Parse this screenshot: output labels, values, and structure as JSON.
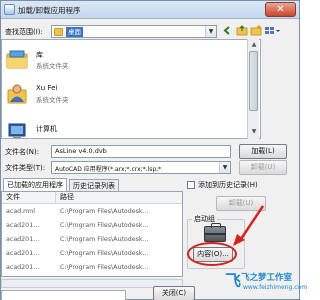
{
  "window": {
    "title": "加载/卸载应用程序",
    "close_label": "✕"
  },
  "look_in": {
    "label": "查找范围(I):",
    "value": "桌面"
  },
  "toolbar": {
    "icons": [
      "back-icon",
      "up-folder-icon",
      "new-folder-icon",
      "views-icon"
    ]
  },
  "files": [
    {
      "name": "库",
      "type": "系统文件夹",
      "icon": "library-icon"
    },
    {
      "name": "Xu Fei",
      "type": "系统文件夹",
      "icon": "user-icon"
    },
    {
      "name": "计算机",
      "type": "",
      "icon": "computer-icon"
    }
  ],
  "file_name": {
    "label": "文件名(N):",
    "value": "AsLine v4.0.dvb"
  },
  "file_type": {
    "label": "文件类型(T):",
    "value": "AutoCAD 应用程序(*.arx;*.crx;*.lsp;*"
  },
  "buttons": {
    "load": "加载(L)",
    "unload": "卸载(U)",
    "contents": "内容(O)...",
    "close": "关闭(C)"
  },
  "tabs": [
    {
      "label": "已加载的应用程序",
      "active": true
    },
    {
      "label": "历史记录列表",
      "active": false
    }
  ],
  "table": {
    "headers": [
      "文件",
      "路径"
    ],
    "rows": [
      [
        "acad.mnl",
        "C:\\Program Files\\Autodesk..."
      ],
      [
        "acad201...",
        "C:\\Program Files\\Autodesk..."
      ],
      [
        "acad201...",
        "C:\\Program Files\\Autodesk..."
      ],
      [
        "acad201...",
        "C:\\Program Files\\Autodesk..."
      ],
      [
        "acad201...",
        "C:\\Program Files\\Autodesk..."
      ]
    ]
  },
  "history_checkbox": {
    "label": "添加到历史记录(H)",
    "checked": false
  },
  "startup_group": {
    "title": "启动组"
  },
  "watermark": {
    "text": "飞之梦工作室",
    "url": "www.feizhimeng.com"
  },
  "colors": {
    "accent": "#3a72c4",
    "highlight": "#d6231c",
    "watermark": "#1f87c9"
  }
}
